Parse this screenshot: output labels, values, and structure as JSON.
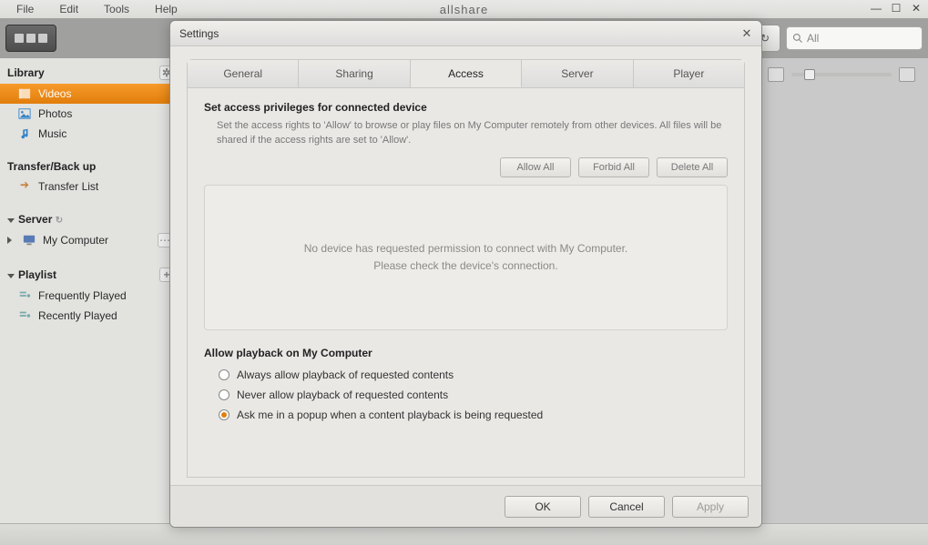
{
  "menu": {
    "file": "File",
    "edit": "Edit",
    "tools": "Tools",
    "help": "Help"
  },
  "app": {
    "title": "allshare"
  },
  "window_controls": {
    "min": "—",
    "max": "☐",
    "close": "✕"
  },
  "search": {
    "placeholder": "All"
  },
  "sidebar": {
    "library_label": "Library",
    "videos": "Videos",
    "photos": "Photos",
    "music": "Music",
    "transfer_label": "Transfer/Back up",
    "transfer_list": "Transfer List",
    "server_label": "Server",
    "my_computer": "My Computer",
    "playlist_label": "Playlist",
    "frequently_played": "Frequently Played",
    "recently_played": "Recently Played"
  },
  "dialog": {
    "title": "Settings",
    "tabs": {
      "general": "General",
      "sharing": "Sharing",
      "access": "Access",
      "server": "Server",
      "player": "Player"
    },
    "access": {
      "heading": "Set access privileges for connected device",
      "desc": "Set the access rights to 'Allow' to browse or play files on My Computer remotely from other devices. All files will be shared if the access rights are set to 'Allow'.",
      "allow_all": "Allow All",
      "forbid_all": "Forbid All",
      "delete_all": "Delete All",
      "empty_line1": "No device has requested permission to connect with My Computer.",
      "empty_line2": "Please check the device's connection.",
      "playback_heading": "Allow playback on My Computer",
      "radio1": "Always allow playback of requested contents",
      "radio2": "Never allow playback of requested contents",
      "radio3": "Ask me in a popup when a content playback is being requested"
    },
    "footer": {
      "ok": "OK",
      "cancel": "Cancel",
      "apply": "Apply"
    }
  }
}
